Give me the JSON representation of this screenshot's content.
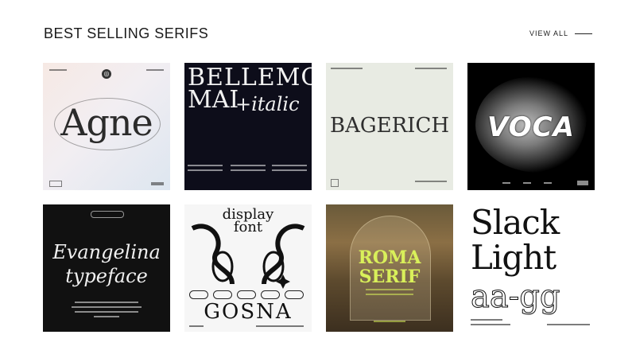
{
  "header": {
    "title": "BEST SELLING SERIFS",
    "view_all": "VIEW ALL"
  },
  "cards": [
    {
      "name": "Agne",
      "lines": [
        "Agne"
      ],
      "bg": "#f2eef2"
    },
    {
      "name": "Bellemo Mai",
      "lines": [
        "BELLEMO",
        "MAI",
        "+italic"
      ],
      "bg": "#0d0d1a"
    },
    {
      "name": "Bagerich",
      "lines": [
        "BAGERICH"
      ],
      "bg": "#e8ebe3"
    },
    {
      "name": "Voca",
      "lines": [
        "VOCA"
      ],
      "bg": "#000000"
    },
    {
      "name": "Evangelina",
      "lines": [
        "Evangelina",
        "typeface"
      ],
      "bg": "#111111"
    },
    {
      "name": "Gosna",
      "lines": [
        "display",
        "font",
        "GOSNA"
      ],
      "bg": "#f6f6f6"
    },
    {
      "name": "Roma Serif",
      "lines": [
        "ROMA",
        "SERIF"
      ],
      "bg": "#6a5a3a"
    },
    {
      "name": "Slack Light",
      "lines": [
        "Slack",
        "Light",
        "aa-gg"
      ],
      "bg": "#ffffff"
    }
  ]
}
